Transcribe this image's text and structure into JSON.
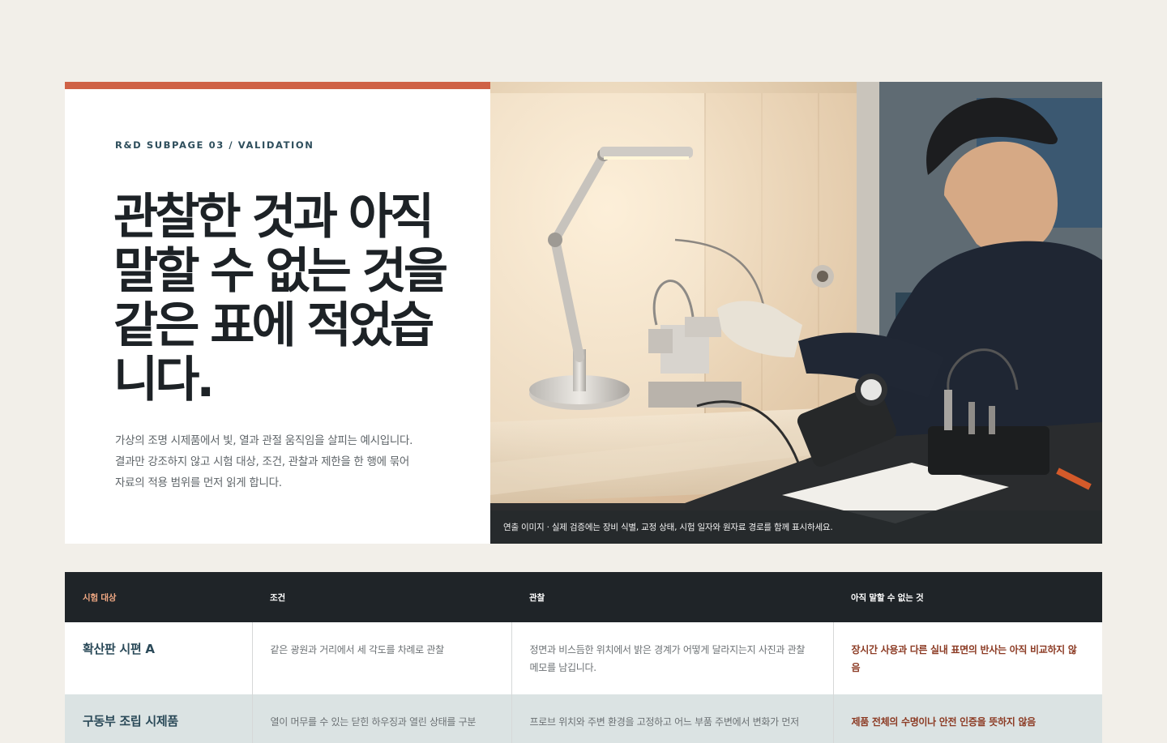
{
  "hero": {
    "eyebrow": "R&D SUBPAGE 03 / VALIDATION",
    "headline": "관찰한 것과 아직 말할 수 없는 것을 같은 표에 적었습니다.",
    "lead_lines": [
      "가상의 조명 시제품에서 빛, 열과 관절 움직임을 살피는 예시입니다.",
      "결과만 강조하지 않고 시험 대상, 조건, 관찰과 제한을 한 행에 묶어",
      "자료의 적용 범위를 먼저 읽게 합니다."
    ],
    "image_caption": "연출 이미지 · 실제 검증에는 장비 식별, 교정 상태, 시험 일자와 원자료 경로를 함께 표시하세요."
  },
  "table": {
    "headers": {
      "target": "시험 대상",
      "condition": "조건",
      "observation": "관찰",
      "limitation": "아직 말할 수 없는 것"
    },
    "rows": [
      {
        "target": "확산판 시편 A",
        "condition": "같은 광원과 거리에서 세 각도를 차례로 관찰",
        "observation": "정면과 비스듬한 위치에서 밝은 경계가 어떻게 달라지는지 사진과 관찰 메모를 남깁니다.",
        "limitation": "장시간 사용과 다른 실내 표면의 반사는 아직 비교하지 않음"
      },
      {
        "target": "구동부 조립 시제품",
        "condition": "열이 머무를 수 있는 닫힌 하우징과 열린 상태를 구분",
        "observation": "프로브 위치와 주변 환경을 고정하고 어느 부품 주변에서 변화가 먼저",
        "limitation": "제품 전체의 수명이나 안전 인증을 뜻하지 않음"
      }
    ]
  },
  "colors": {
    "accent": "#cf6246",
    "header_bg": "#1f2428",
    "header_target": "#f0a883",
    "limitation_text": "#8c3b24",
    "target_text": "#2b4a59"
  }
}
